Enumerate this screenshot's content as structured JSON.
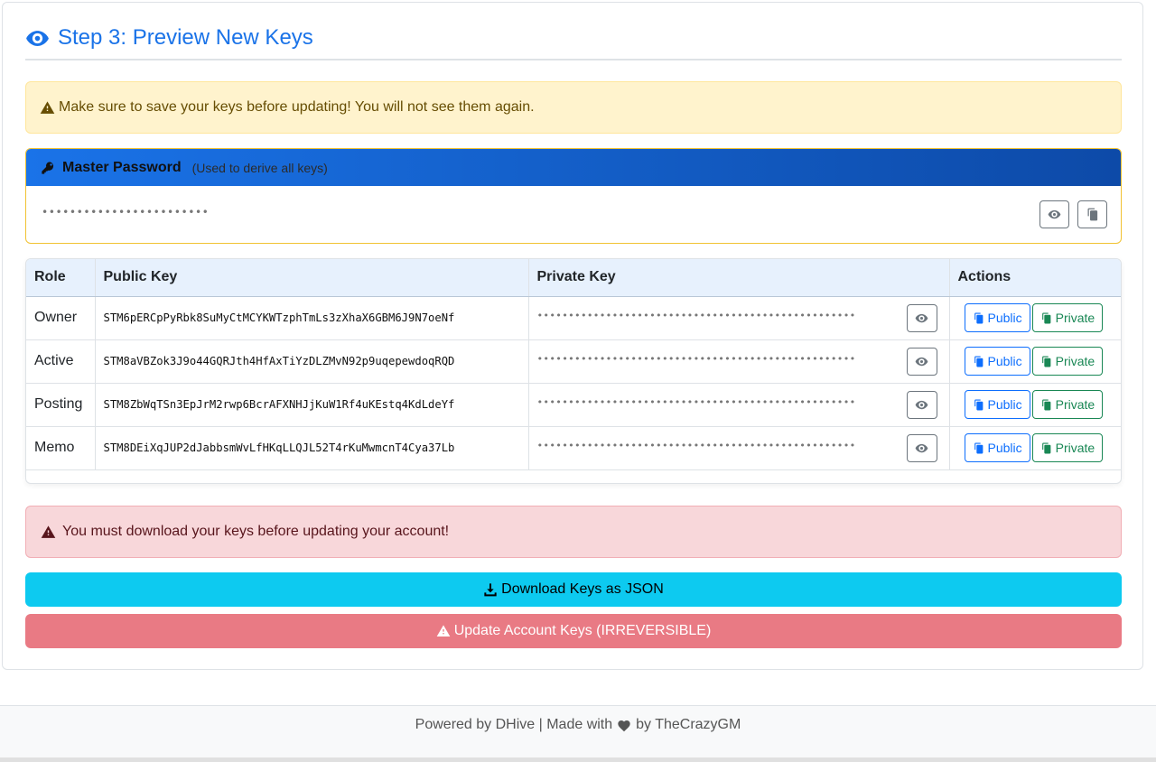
{
  "step": {
    "title": "Step 3: Preview New Keys",
    "icon": "eye-icon",
    "color": "#1a73e8"
  },
  "warning": {
    "text": "Make sure to save your keys before updating! You will not see them again.",
    "icon": "warning-triangle-icon"
  },
  "master_password": {
    "title": "Master Password",
    "subtitle": "(Used to derive all keys)",
    "masked_value": "••••••••••••••••••••••••",
    "icon": "key-icon",
    "show_icon": "eye-icon",
    "copy_icon": "copy-icon"
  },
  "keys_table": {
    "headers": [
      "Role",
      "Public Key",
      "Private Key",
      "Actions"
    ],
    "rows": [
      {
        "role": "Owner",
        "public_key": "STM6pERCpPyRbk8SuMyCtMCYKWTzphTmLs3zXhaX6GBM6J9N7oeNf",
        "private_masked": "•••••••••••••••••••••••••••••••••••••••••••••••••••"
      },
      {
        "role": "Active",
        "public_key": "STM8aVBZok3J9o44GQRJth4HfAxTiYzDLZMvN92p9uqepewdoqRQD",
        "private_masked": "•••••••••••••••••••••••••••••••••••••••••••••••••••"
      },
      {
        "role": "Posting",
        "public_key": "STM8ZbWqTSn3EpJrM2rwp6BcrAFXNHJjKuW1Rf4uKEstq4KdLdeYf",
        "private_masked": "•••••••••••••••••••••••••••••••••••••••••••••••••••"
      },
      {
        "role": "Memo",
        "public_key": "STM8DEiXqJUP2dJabbsmWvLfHKqLLQJL52T4rKuMwmcnT4Cya37Lb",
        "private_masked": "•••••••••••••••••••••••••••••••••••••••••••••••••••"
      }
    ],
    "public_button_label": "Public",
    "private_button_label": "Private"
  },
  "danger": {
    "text": "You must download your keys before updating your account!",
    "icon": "warning-triangle-icon"
  },
  "download_button": {
    "label": "Download Keys as JSON",
    "icon": "download-icon",
    "color": "#0dcaf0"
  },
  "update_button": {
    "label": "Update Account Keys (IRREVERSIBLE)",
    "icon": "warning-triangle-icon",
    "color": "#e97a84"
  },
  "footer": {
    "text_before": "Powered by DHive | Made with",
    "text_after": "by TheCrazyGM",
    "icon": "heart-icon"
  }
}
